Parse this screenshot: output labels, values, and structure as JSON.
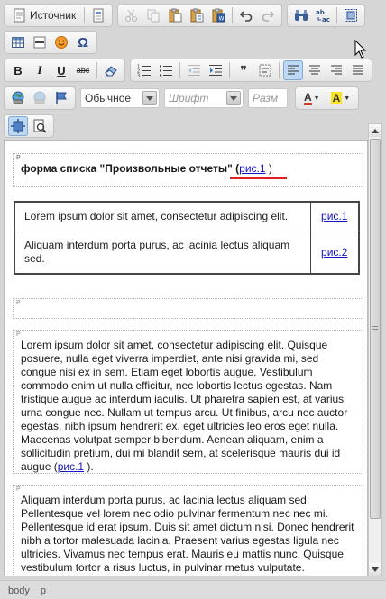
{
  "toolbar": {
    "source_label": "Источник",
    "format_value": "Обычное",
    "font_placeholder": "Шрифт",
    "size_placeholder": "Разм",
    "text_color_letter": "A",
    "bg_color_letter": "A",
    "bold_letter": "B",
    "italic_letter": "I",
    "underline_letter": "U",
    "strike_label": "abc",
    "quote_glyph": "❞",
    "omega_glyph": "Ω"
  },
  "editor": {
    "p_tag": "P",
    "heading_text": "форма списка \"Произвольные отчеты\" (",
    "heading_link": "рис.1",
    "heading_close": " )",
    "table": {
      "rows": [
        {
          "text": "Lorem ipsum dolor sit amet, consectetur adipiscing elit.",
          "ref": "рис.1"
        },
        {
          "text": "Aliquam interdum porta purus, ac lacinia lectus aliquam sed.",
          "ref": "рис.2"
        }
      ]
    },
    "para1_text": "Lorem ipsum dolor sit amet, consectetur adipiscing elit. Quisque posuere, nulla eget viverra imperdiet, ante nisi gravida mi, sed congue nisi ex in sem. Etiam eget lobortis augue. Vestibulum commodo enim ut nulla efficitur, nec lobortis lectus egestas. Nam tristique augue ac interdum iaculis. Ut pharetra sapien est, at varius urna congue nec. Nullam ut tempus arcu. Ut finibus, arcu nec auctor egestas, nibh ipsum hendrerit ex, eget ultricies leo eros eget nulla. Maecenas volutpat semper bibendum. Aenean aliquam, enim a sollicitudin pretium, dui mi blandit sem, at scelerisque mauris dui id augue (",
    "para1_link": "рис.1",
    "para1_close": " ).",
    "para2_text": "Aliquam interdum porta purus, ac lacinia lectus aliquam sed. Pellentesque vel lorem nec odio pulvinar fermentum nec nec mi. Pellentesque id erat ipsum. Duis sit amet dictum nisi. Donec hendrerit nibh a tortor malesuada lacinia. Praesent varius egestas ligula nec ultricies. Vivamus nec tempus erat. Mauris eu mattis nunc. Quisque vestibulum tortor a risus luctus, in pulvinar metus vulputate."
  },
  "statusbar": {
    "path": [
      "body",
      "p"
    ]
  },
  "colors": {
    "link": "#1414c8",
    "underline_mark": "#e02020",
    "active_button": "#bcd8f3"
  }
}
